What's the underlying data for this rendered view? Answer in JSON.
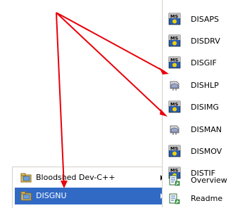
{
  "programs_menu": {
    "items": [
      {
        "label": "Bloodshed Dev-C++",
        "icon": "program-group-folder-icon",
        "has_submenu": true,
        "selected": false
      },
      {
        "label": "DISGNU",
        "icon": "program-group-folder-icon",
        "has_submenu": true,
        "selected": true
      }
    ]
  },
  "submenu": {
    "items": [
      {
        "label": "DISAPS",
        "icon": "ms-dos-program-icon"
      },
      {
        "label": "DISDRV",
        "icon": "ms-dos-program-icon"
      },
      {
        "label": "DISGIF",
        "icon": "ms-dos-program-icon"
      },
      {
        "label": "DISHLP",
        "icon": "help-file-icon"
      },
      {
        "label": "DISIMG",
        "icon": "ms-dos-program-icon"
      },
      {
        "label": "DISMAN",
        "icon": "help-file-icon"
      },
      {
        "label": "DISMOV",
        "icon": "ms-dos-program-icon"
      },
      {
        "label": "DISTIF",
        "icon": "ms-dos-program-icon"
      },
      {
        "label": "Overview",
        "icon": "document-shortcut-icon"
      },
      {
        "label": "Readme",
        "icon": "document-shortcut-icon"
      }
    ]
  },
  "colors": {
    "selection": "#316ac5",
    "annotation_arrows": "#e8000a",
    "menu_background": "#ffffff"
  }
}
